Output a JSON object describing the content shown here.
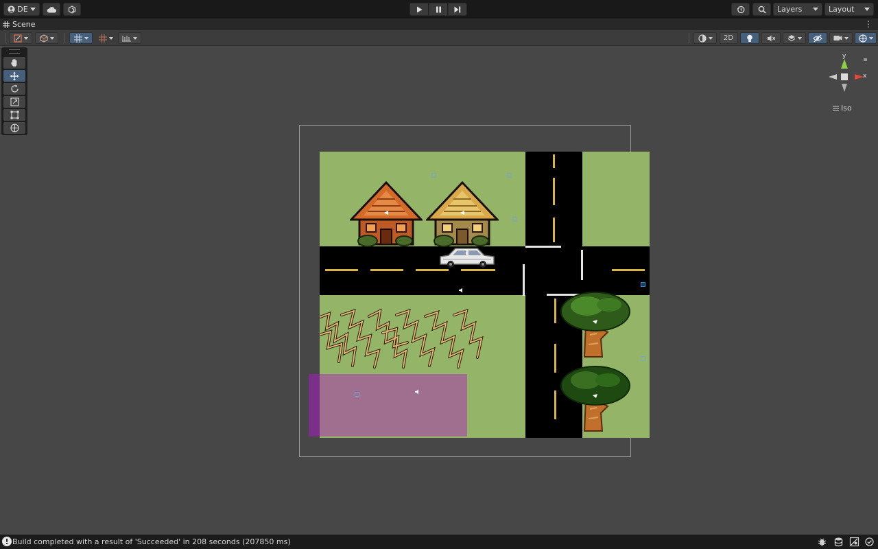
{
  "toolbar": {
    "account_label": "DE",
    "layers_label": "Layers",
    "layout_label": "Layout"
  },
  "tab": {
    "scene_label": "Scene",
    "menu_glyph": "⋮"
  },
  "scene_toolbar": {
    "mode_2d_label": "2D"
  },
  "gizmo": {
    "y_label": "y",
    "x_label": "x",
    "projection_label": "Iso"
  },
  "status": {
    "message": "Build completed with a result of 'Succeeded' in 208 seconds (207850 ms)",
    "icon_glyph": "!"
  },
  "colors": {
    "accent": "#46607c",
    "grass": "#94b468",
    "road": "#000000",
    "lane_marking": "#d8b640",
    "zone_pink": "#a06e8e",
    "zone_purple": "#7a3088"
  }
}
